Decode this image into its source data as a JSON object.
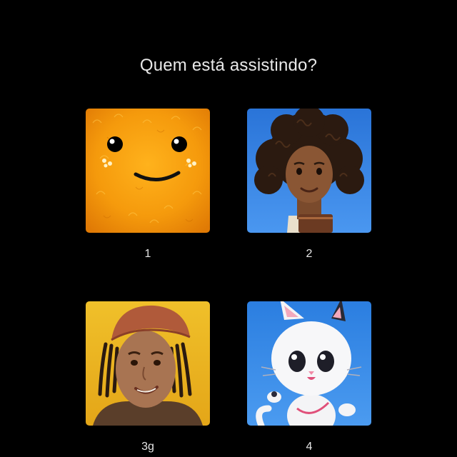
{
  "header": {
    "title": "Quem está assistindo?"
  },
  "profiles": [
    {
      "name": "1",
      "avatar": "orange-fluffy-smiley-avatar",
      "accent": "#f7a310"
    },
    {
      "name": "2",
      "avatar": "curly-haired-girl-avatar",
      "accent": "#2f7fe0"
    },
    {
      "name": "3g",
      "avatar": "bandana-pirate-avatar",
      "accent": "#e8b21e"
    },
    {
      "name": "4",
      "avatar": "white-cat-avatar",
      "accent": "#2f86e6"
    }
  ]
}
